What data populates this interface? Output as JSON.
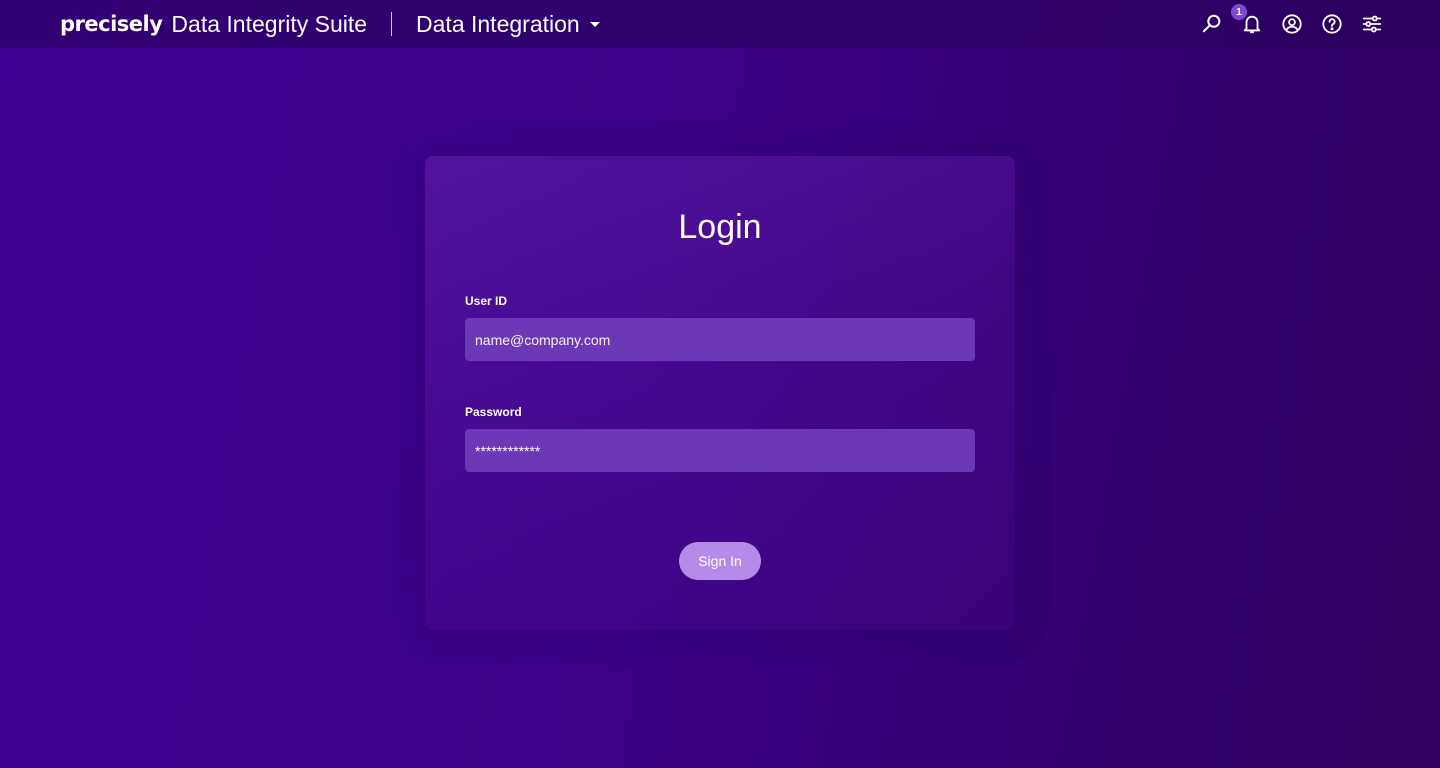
{
  "header": {
    "logo": "precisely",
    "suite_name": "Data Integrity Suite",
    "product_name": "Data Integration",
    "notification_count": "1",
    "icons": [
      "search-icon",
      "bell-icon",
      "user-account-icon",
      "help-icon",
      "settings-sliders-icon"
    ]
  },
  "login": {
    "title": "Login",
    "user_id_label": "User ID",
    "user_id_placeholder": "name@company.com",
    "password_label": "Password",
    "password_value": "************",
    "sign_in_label": "Sign In"
  },
  "colors": {
    "background": "#3d018c",
    "input_background": "#6c39b6",
    "button": "#b48be8"
  }
}
